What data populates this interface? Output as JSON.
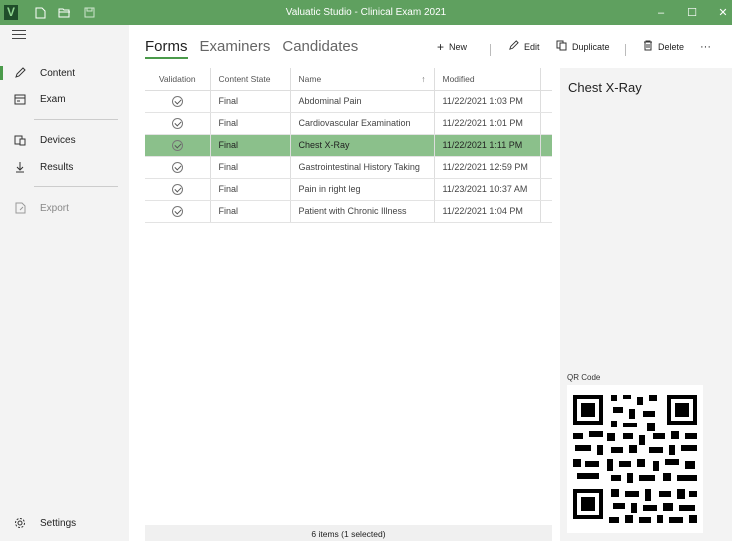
{
  "window": {
    "title": "Valuatic Studio - Clinical Exam 2021",
    "logo_letter": "V",
    "accent": "#5fa05f",
    "toolbar_icons": [
      "new-file-icon",
      "open-folder-icon",
      "save-icon"
    ],
    "controls": {
      "minimize": "–",
      "maximize": "☐",
      "close": "✕"
    }
  },
  "sidebar": {
    "items": [
      {
        "label": "Content",
        "icon": "pencil-icon",
        "active": true
      },
      {
        "label": "Exam",
        "icon": "exam-icon"
      },
      {
        "label": "Devices",
        "icon": "devices-icon"
      },
      {
        "label": "Results",
        "icon": "download-icon"
      },
      {
        "label": "Export",
        "icon": "export-icon",
        "disabled": true
      }
    ],
    "settings": {
      "label": "Settings",
      "icon": "gear-icon"
    }
  },
  "tabs": [
    {
      "label": "Forms",
      "active": true
    },
    {
      "label": "Examiners"
    },
    {
      "label": "Candidates"
    }
  ],
  "commands": {
    "new": "New",
    "edit": "Edit",
    "duplicate": "Duplicate",
    "delete": "Delete",
    "more": "···"
  },
  "table": {
    "columns": {
      "validation": "Validation",
      "content_state": "Content State",
      "name": "Name",
      "modified": "Modified"
    },
    "rows": [
      {
        "state": "Final",
        "name": "Abdominal Pain",
        "modified": "11/22/2021 1:03 PM"
      },
      {
        "state": "Final",
        "name": "Cardiovascular Examination",
        "modified": "11/22/2021 1:01 PM"
      },
      {
        "state": "Final",
        "name": "Chest X-Ray",
        "modified": "11/22/2021 1:11 PM",
        "selected": true
      },
      {
        "state": "Final",
        "name": "Gastrointestinal History Taking",
        "modified": "11/22/2021 12:59 PM"
      },
      {
        "state": "Final",
        "name": "Pain in right leg",
        "modified": "11/23/2021 10:37 AM"
      },
      {
        "state": "Final",
        "name": "Patient with Chronic Illness",
        "modified": "11/22/2021 1:04 PM"
      }
    ],
    "selection_color": "#8bc08b"
  },
  "status": "6 items (1 selected)",
  "detail": {
    "title": "Chest X-Ray",
    "qr_label": "QR Code"
  }
}
